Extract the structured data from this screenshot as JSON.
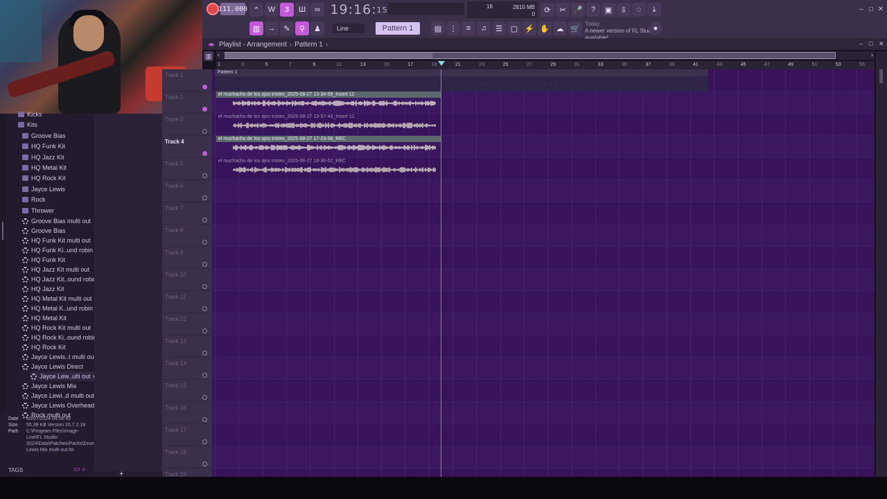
{
  "toolbar": {
    "tempo": "111.000",
    "clock_main": "19:16",
    "clock_sub": "15",
    "cpu": "16",
    "memory": "2810 MB",
    "meter_zero": "0",
    "line_mode": "Line",
    "pattern": "Pattern 1",
    "news_today": "Today",
    "news_text": "A newer version of FL Studio is available!"
  },
  "browser": {
    "items": [
      {
        "label": "Kicks",
        "type": "folder"
      },
      {
        "label": "Kits",
        "type": "folder"
      },
      {
        "label": "Groove Bias",
        "type": "folder"
      },
      {
        "label": "HQ Funk Kit",
        "type": "folder"
      },
      {
        "label": "HQ Jazz Kit",
        "type": "folder"
      },
      {
        "label": "HQ Metal Kit",
        "type": "folder"
      },
      {
        "label": "HQ Rock Kit",
        "type": "folder"
      },
      {
        "label": "Jayce Lewis",
        "type": "folder"
      },
      {
        "label": "Rock",
        "type": "folder"
      },
      {
        "label": "Thrower",
        "type": "folder"
      },
      {
        "label": "Groove Bias multi out",
        "type": "preset"
      },
      {
        "label": "Groove Bias",
        "type": "preset"
      },
      {
        "label": "HQ Funk Kit multi out",
        "type": "preset"
      },
      {
        "label": "HQ Funk Ki..und robin",
        "type": "preset"
      },
      {
        "label": "HQ Funk Kit",
        "type": "preset"
      },
      {
        "label": "HQ Jazz Kit multi out",
        "type": "preset"
      },
      {
        "label": "HQ Jazz Kit..ound robin",
        "type": "preset"
      },
      {
        "label": "HQ Jazz Kit",
        "type": "preset"
      },
      {
        "label": "HQ Metal Kit multi out",
        "type": "preset"
      },
      {
        "label": "HQ Metal K..und robin",
        "type": "preset"
      },
      {
        "label": "HQ Metal Kit",
        "type": "preset"
      },
      {
        "label": "HQ Rock Kit multi out",
        "type": "preset"
      },
      {
        "label": "HQ Rock Ki..ound robin",
        "type": "preset"
      },
      {
        "label": "HQ Rock Kit",
        "type": "preset"
      },
      {
        "label": "Jayce Lewis..t multi out",
        "type": "preset"
      },
      {
        "label": "Jayce Lewis Direct",
        "type": "preset"
      },
      {
        "label": "Jayce Lew..ulti out ★",
        "type": "preset"
      },
      {
        "label": "Jayce Lewis Mix",
        "type": "preset"
      },
      {
        "label": "Jayce Lewi..d multi out",
        "type": "preset"
      },
      {
        "label": "Jayce Lewis Overhead",
        "type": "preset"
      },
      {
        "label": "Rock multi out",
        "type": "preset"
      }
    ],
    "info": {
      "date_label": "Date",
      "date": "16/07/2024 04:56:42",
      "size_label": "Size",
      "size": "55.39 KB",
      "version": "Version 20.7.2.18",
      "path_label": "Path",
      "path": "C:\\Program Files\\Image-Line\\FL Studio 2024\\Data\\Patches\\Packs\\Drums\\Kits\\Jayce Lewis Mix multi out.fst"
    },
    "tags_label": "TAGS"
  },
  "playlist": {
    "title": "Playlist - Arrangement",
    "pattern": "Pattern 1",
    "pattern_clip": "Pattern 1",
    "ruler": [
      "1",
      "3",
      "5",
      "7",
      "9",
      "11",
      "13",
      "15",
      "17",
      "19",
      "21",
      "23",
      "25",
      "27",
      "29",
      "31",
      "33",
      "35",
      "37",
      "39",
      "41",
      "43",
      "45",
      "47",
      "49",
      "51",
      "53",
      "55"
    ],
    "tracks": [
      "Track 1",
      "Track 2",
      "Track 3",
      "Track 4",
      "Track 5",
      "Track 6",
      "Track 7",
      "Track 8",
      "Track 9",
      "Track 10",
      "Track 11",
      "Track 12",
      "Track 13",
      "Track 14",
      "Track 15",
      "Track 16",
      "Track 17",
      "Track 18",
      "Track 19"
    ],
    "clips": [
      {
        "label": "el muchacho de los ojos tristes_2025-08-27 13-34-59_Insert 12",
        "state": "sel"
      },
      {
        "label": "el muchacho de los ojos tristes_2025-08-27 13-57-43_Insert 12",
        "state": "dim"
      },
      {
        "label": "el muchacho de los ojos tristes_2025-08-27 17-23-58_REC",
        "state": "sel"
      },
      {
        "label": "el muchacho de los ojos tristes_2025-08-27 18-30-52_REC",
        "state": "dim"
      }
    ]
  }
}
